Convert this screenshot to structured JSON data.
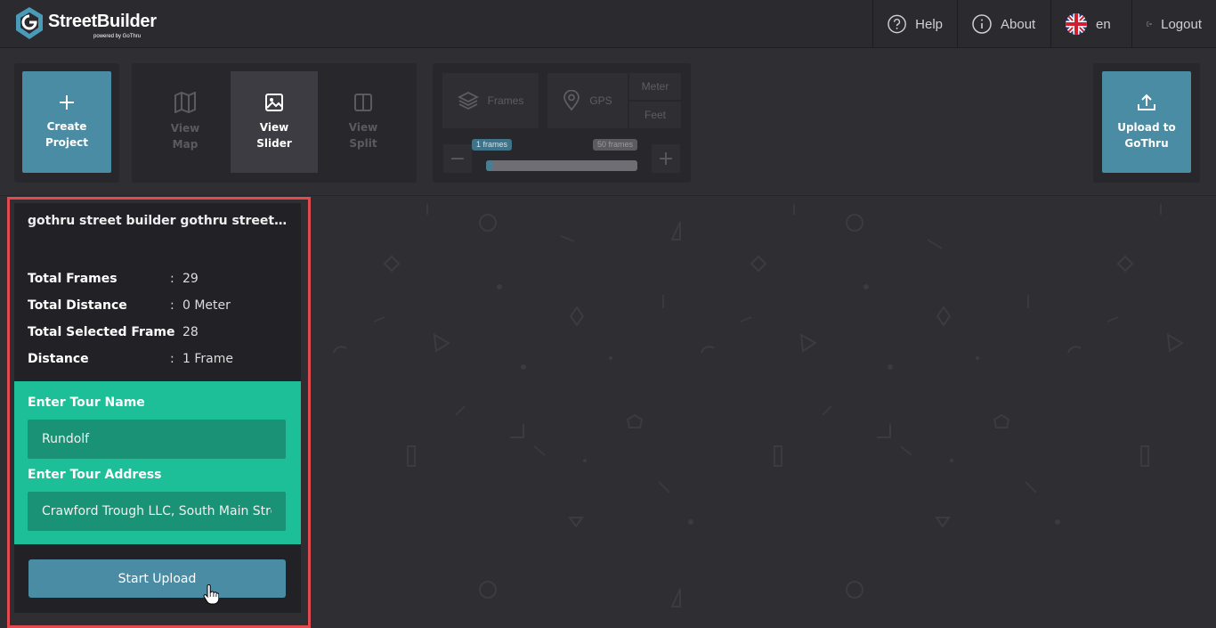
{
  "app": {
    "name": "StreetBuilder",
    "tagline": "powered by GoThru"
  },
  "nav": {
    "help": "Help",
    "about": "About",
    "language": "en",
    "logout": "Logout"
  },
  "toolbar": {
    "create_project": "Create Project",
    "view_map": "View Map",
    "view_slider": "View Slider",
    "view_split": "View Split",
    "frames": "Frames",
    "gps": "GPS",
    "meter": "Meter",
    "feet": "Feet",
    "slider_min_label": "1 frames",
    "slider_max_label": "50 frames",
    "upload": "Upload to GoThru"
  },
  "project": {
    "title": "gothru street builder gothru streetbuilder",
    "stats": [
      {
        "label": "Total Frames",
        "value": "29"
      },
      {
        "label": "Total Distance",
        "value": "0 Meter"
      },
      {
        "label": "Total Selected Frame",
        "value": "28"
      },
      {
        "label": "Distance",
        "value": "1 Frame"
      }
    ],
    "separator": ":",
    "tour_name_label": "Enter Tour Name",
    "tour_name_value": "Rundolf",
    "tour_address_label": "Enter Tour Address",
    "tour_address_value": "Crawford Trough LLC, South Main Street",
    "start_upload": "Start Upload"
  },
  "colors": {
    "accent": "#4a8ca3",
    "form_bg": "#1dbf98",
    "highlight": "#e24a4f"
  }
}
